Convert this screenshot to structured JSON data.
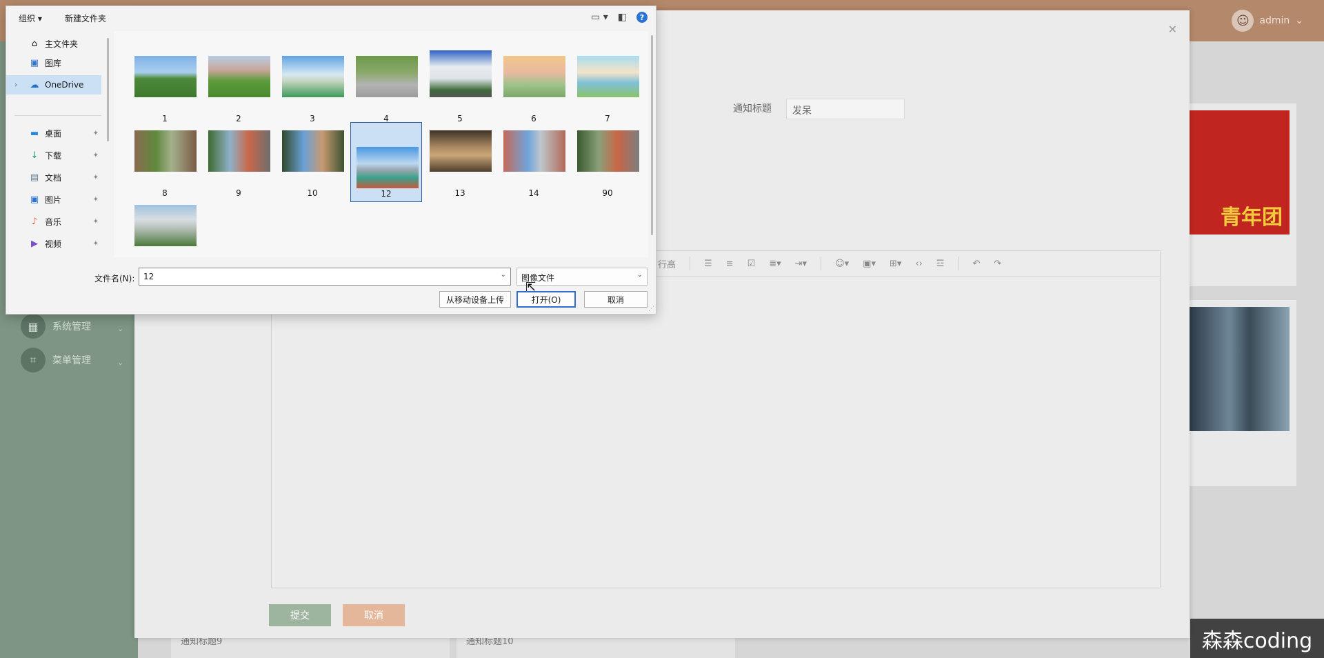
{
  "app": {
    "user": "admin",
    "sidebar": [
      {
        "label": "系统管理"
      },
      {
        "label": "菜单管理"
      }
    ],
    "card_text": "青年团",
    "bottom_items": [
      "通知标题9",
      "通知标题10"
    ]
  },
  "modal": {
    "title_label": "通知标题",
    "title_value": "发呆",
    "toolbar_lineheight": "行高",
    "submit_label": "提交",
    "cancel_label": "取消"
  },
  "dialog": {
    "organize": "组织 ▾",
    "new_folder": "新建文件夹",
    "nav": {
      "home": "主文件夹",
      "gallery": "图库",
      "onedrive": "OneDrive",
      "desktop": "桌面",
      "downloads": "下载",
      "documents": "文档",
      "pictures": "图片",
      "music": "音乐",
      "videos": "视频"
    },
    "files": [
      "1",
      "2",
      "3",
      "4",
      "5",
      "6",
      "7",
      "8",
      "9",
      "10",
      "12",
      "13",
      "14",
      "90",
      ""
    ],
    "selected_file": "12",
    "filename_label": "文件名(N):",
    "filename_value": "12",
    "filetype": "图像文件",
    "upload_mobile": "从移动设备上传",
    "open": "打开(O)",
    "cancel": "取消"
  },
  "watermark": "森森coding",
  "colors": {
    "header": "#b4886a",
    "sidebar": "#7e9583",
    "submit": "#9db49f",
    "cancel": "#e4b79a",
    "selection": "#cce0f5"
  }
}
